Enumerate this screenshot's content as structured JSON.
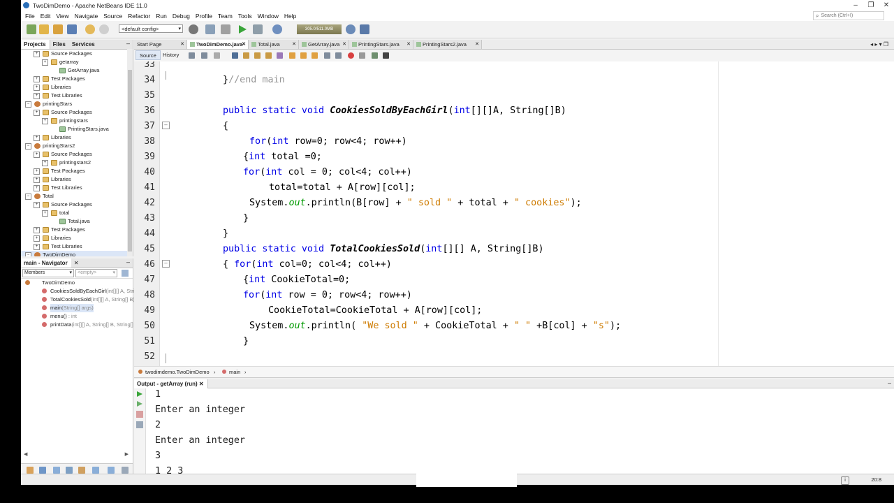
{
  "window": {
    "title": "TwoDimDemo - Apache NetBeans IDE 11.0"
  },
  "menu": [
    "File",
    "Edit",
    "View",
    "Navigate",
    "Source",
    "Refactor",
    "Run",
    "Debug",
    "Profile",
    "Team",
    "Tools",
    "Window",
    "Help"
  ],
  "search": {
    "placeholder": "Search (Ctrl+I)"
  },
  "toolbar": {
    "config": "<default config>",
    "memory": "305.0/511.0MB"
  },
  "projects_panel": {
    "tabs": [
      "Projects",
      "Files",
      "Services"
    ],
    "tree": [
      {
        "label": "Source Packages",
        "depth": 2,
        "icon": "pkg"
      },
      {
        "label": "getarray",
        "depth": 3,
        "icon": "pkg"
      },
      {
        "label": "GetArray.java",
        "depth": 4,
        "icon": "jfile"
      },
      {
        "label": "Test Packages",
        "depth": 2,
        "icon": "pkg"
      },
      {
        "label": "Libraries",
        "depth": 2,
        "icon": "pkg"
      },
      {
        "label": "Test Libraries",
        "depth": 2,
        "icon": "pkg"
      },
      {
        "label": "printingStars",
        "depth": 1,
        "icon": "proj"
      },
      {
        "label": "Source Packages",
        "depth": 2,
        "icon": "pkg"
      },
      {
        "label": "printingstars",
        "depth": 3,
        "icon": "pkg"
      },
      {
        "label": "PrintingStars.java",
        "depth": 4,
        "icon": "jfile"
      },
      {
        "label": "Libraries",
        "depth": 2,
        "icon": "pkg"
      },
      {
        "label": "printingStars2",
        "depth": 1,
        "icon": "proj"
      },
      {
        "label": "Source Packages",
        "depth": 2,
        "icon": "pkg"
      },
      {
        "label": "printingstars2",
        "depth": 3,
        "icon": "pkg"
      },
      {
        "label": "Test Packages",
        "depth": 2,
        "icon": "pkg"
      },
      {
        "label": "Libraries",
        "depth": 2,
        "icon": "pkg"
      },
      {
        "label": "Test Libraries",
        "depth": 2,
        "icon": "pkg"
      },
      {
        "label": "Total",
        "depth": 1,
        "icon": "proj"
      },
      {
        "label": "Source Packages",
        "depth": 2,
        "icon": "pkg"
      },
      {
        "label": "total",
        "depth": 3,
        "icon": "pkg"
      },
      {
        "label": "Total.java",
        "depth": 4,
        "icon": "jfile"
      },
      {
        "label": "Test Packages",
        "depth": 2,
        "icon": "pkg"
      },
      {
        "label": "Libraries",
        "depth": 2,
        "icon": "pkg"
      },
      {
        "label": "Test Libraries",
        "depth": 2,
        "icon": "pkg"
      },
      {
        "label": "TwoDimDemo",
        "depth": 1,
        "icon": "proj",
        "selected": true
      }
    ]
  },
  "navigator": {
    "title": "main - Navigator",
    "filter": "Members",
    "filter_placeholder": "<empty>",
    "root": "TwoDimDemo",
    "members": [
      {
        "name": "CookiesSoldByEachGirl",
        "sig": "(int[][] A, String[] B)"
      },
      {
        "name": "TotalCookiesSold",
        "sig": "(int[][] A, String[] B)"
      },
      {
        "name": "main",
        "sig": "(String[] args)",
        "selected": true
      },
      {
        "name": "menu()",
        "sig": " : int"
      },
      {
        "name": "printData",
        "sig": "(int[][] A, String[] B, String[] C)"
      }
    ]
  },
  "editor_tabs": [
    {
      "label": "Start Page",
      "active": false
    },
    {
      "label": "TwoDimDemo.java",
      "active": true
    },
    {
      "label": "Total.java",
      "active": false
    },
    {
      "label": "GetArray.java",
      "active": false
    },
    {
      "label": "PrintingStars.java",
      "active": false
    },
    {
      "label": "PrintingStars2.java",
      "active": false
    }
  ],
  "editor_toolbar": {
    "source": "Source",
    "history": "History"
  },
  "code": [
    {
      "n": "33"
    },
    {
      "n": "34"
    },
    {
      "n": "35"
    },
    {
      "n": "36"
    },
    {
      "n": "37"
    },
    {
      "n": "38"
    },
    {
      "n": "39"
    },
    {
      "n": "40"
    },
    {
      "n": "41"
    },
    {
      "n": "42"
    },
    {
      "n": "43"
    },
    {
      "n": "44"
    },
    {
      "n": "45"
    },
    {
      "n": "46"
    },
    {
      "n": "47"
    },
    {
      "n": "48"
    },
    {
      "n": "49"
    },
    {
      "n": "50"
    },
    {
      "n": "51"
    },
    {
      "n": "52"
    }
  ],
  "code_text": {
    "l34a": "}",
    "l34b": "//end main",
    "l36a": "public static void ",
    "l36b": "CookiesSoldByEachGirl",
    "l36c": "(",
    "l36d": "int",
    "l36e": "[][]A, String[]B)",
    "l37": "{",
    "l38a": "for",
    "l38b": "(",
    "l38c": "int",
    "l38d": " row=0; row<4; row++)",
    "l39a": "{",
    "l39b": "int",
    "l39c": " total =0;",
    "l40a": "for",
    "l40b": "(",
    "l40c": "int",
    "l40d": " col = 0; col<4; col++)",
    "l41": "total=total + A[row][col];",
    "l42a": "System.",
    "l42b": "out",
    "l42c": ".println(B[row] + ",
    "l42d": "\" sold \"",
    "l42e": " + total + ",
    "l42f": "\" cookies\"",
    "l42g": ");",
    "l43": "}",
    "l44": "}",
    "l45a": "public static void ",
    "l45b": "TotalCookiesSold",
    "l45c": "(",
    "l45d": "int",
    "l45e": "[][] A, String[]B)",
    "l46a": "{ ",
    "l46b": "for",
    "l46c": "(",
    "l46d": "int",
    "l46e": " col=0; col<4; col++)",
    "l47a": "{",
    "l47b": "int",
    "l47c": " CookieTotal=0;",
    "l48a": "for",
    "l48b": "(",
    "l48c": "int",
    "l48d": " row = 0; row<4; row++)",
    "l49": "CookieTotal=CookieTotal + A[row][col];",
    "l50a": "System.",
    "l50b": "out",
    "l50c": ".println( ",
    "l50d": "\"We sold \"",
    "l50e": " + CookieTotal + ",
    "l50f": "\" \"",
    "l50g": " +B[col] + ",
    "l50h": "\"s\"",
    "l50i": ");",
    "l51": "}"
  },
  "breadcrumb": {
    "cls": "twodimdemo.TwoDimDemo",
    "method": "main"
  },
  "output": {
    "title": "Output - getArray (run)",
    "lines": [
      "1",
      "Enter an integer",
      "2",
      "Enter an integer",
      "3",
      "1 2 3"
    ]
  },
  "status": {
    "position": "20:8"
  },
  "colors": {
    "keyword": "#0000e6",
    "string": "#ce7b00",
    "comment": "#969696",
    "field": "#009900"
  }
}
